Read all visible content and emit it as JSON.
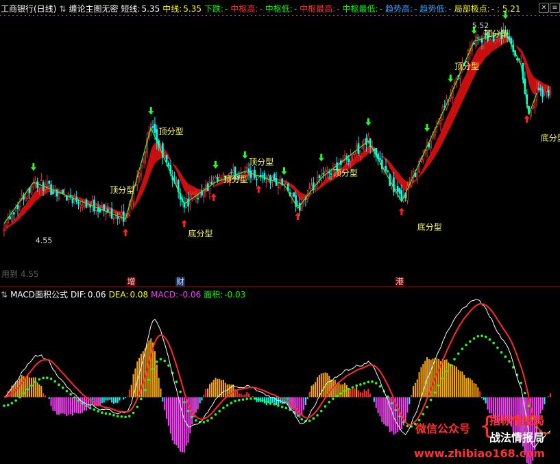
{
  "header": {
    "stock": "工商银行(日线)",
    "indicator": "缠论主图无密",
    "fields": [
      {
        "label": "短线:",
        "value": "5.35",
        "color": "#ffffff"
      },
      {
        "label": "中线:",
        "value": "5.35",
        "color": "#ffff00"
      },
      {
        "label": "下跌:",
        "value": "-",
        "color": "#00ff00"
      },
      {
        "label": "中枢高:",
        "value": "-",
        "color": "#ff3030"
      },
      {
        "label": "中枢低:",
        "value": "-",
        "color": "#00ff00"
      },
      {
        "label": "中枢最高:",
        "value": "-",
        "color": "#ff3030"
      },
      {
        "label": "中枢最低:",
        "value": "-",
        "color": "#00ff00"
      },
      {
        "label": "趋势高:",
        "value": "-",
        "color": "#40a0ff"
      },
      {
        "label": "趋势低:",
        "value": "-",
        "color": "#40a0ff"
      },
      {
        "label": "局部极点:",
        "value": "- : 5.21",
        "color": "#ffff00"
      }
    ]
  },
  "macd_header": {
    "title": "MACD面积公式",
    "fields": [
      {
        "label": "DIF:",
        "value": "0.06",
        "color": "#ffffff"
      },
      {
        "label": "DEA:",
        "value": "0.08",
        "color": "#ffff00"
      },
      {
        "label": "MACD:",
        "value": "-0.06",
        "color": "#ff40ff"
      },
      {
        "label": "面积:",
        "value": "-0.03",
        "color": "#00ff00"
      }
    ]
  },
  "icons": {
    "toggle": "swap-icon",
    "close": "close-icon",
    "menu": "menu-icon"
  },
  "colors": {
    "up": "#ff3030",
    "down": "#00ffff",
    "band": "#dd1111",
    "zigzag": "#33ff33",
    "text_yellow": "#ffff66",
    "buy": "#ff2020",
    "sell": "#22ff22",
    "separator": "#b00000"
  },
  "chart_data": [
    {
      "type": "candlestick",
      "ylim": [
        4.4,
        5.6
      ],
      "price_labels": [
        {
          "text": "5.52",
          "x_index": 239,
          "price": 5.54
        },
        {
          "text": "4.55",
          "x_index": 16,
          "price": 4.55
        }
      ],
      "top_pattern_label": "顶分型",
      "bottom_pattern_label": "底分型",
      "pattern_labels": [
        {
          "text": "顶分型",
          "x_index": 54,
          "price": 4.78
        },
        {
          "text": "顶分型",
          "x_index": 79,
          "price": 5.05
        },
        {
          "text": "顶分型",
          "x_index": 112,
          "price": 4.83
        },
        {
          "text": "顶分型",
          "x_index": 125,
          "price": 4.91
        },
        {
          "text": "顶分型",
          "x_index": 168,
          "price": 4.86
        },
        {
          "text": "顶分型",
          "x_index": 230,
          "price": 5.35
        },
        {
          "text": "顶分型",
          "x_index": 245,
          "price": 5.5
        },
        {
          "text": "底分型",
          "x_index": 94,
          "price": 4.58
        },
        {
          "text": "底分型",
          "x_index": 211,
          "price": 4.61
        },
        {
          "text": "底分型",
          "x_index": 274,
          "price": 5.02
        }
      ],
      "events": [
        {
          "text": "增",
          "x_index": 65,
          "color": "#ffcccc",
          "bg": "#880000"
        },
        {
          "text": "财",
          "x_index": 90,
          "color": "#cce0ff",
          "bg": "#224488"
        },
        {
          "text": "港",
          "x_index": 202,
          "color": "#ffcccc",
          "bg": "#880000"
        }
      ],
      "zigzag": [
        {
          "i": 0,
          "p": 4.64
        },
        {
          "i": 15,
          "p": 4.83
        },
        {
          "i": 62,
          "p": 4.66
        },
        {
          "i": 75,
          "p": 5.08
        },
        {
          "i": 92,
          "p": 4.73
        },
        {
          "i": 108,
          "p": 4.83
        },
        {
          "i": 123,
          "p": 4.88
        },
        {
          "i": 143,
          "p": 4.82
        },
        {
          "i": 150,
          "p": 4.71
        },
        {
          "i": 162,
          "p": 4.85
        },
        {
          "i": 186,
          "p": 5.02
        },
        {
          "i": 203,
          "p": 4.74
        },
        {
          "i": 228,
          "p": 5.23
        },
        {
          "i": 240,
          "p": 5.48
        },
        {
          "i": 256,
          "p": 5.52
        },
        {
          "i": 264,
          "p": 5.37
        },
        {
          "i": 268,
          "p": 5.14
        },
        {
          "i": 272,
          "p": 5.24
        }
      ],
      "buy_points": [
        {
          "i": 62
        },
        {
          "i": 92
        },
        {
          "i": 107
        },
        {
          "i": 130
        },
        {
          "i": 150
        },
        {
          "i": 203
        },
        {
          "i": 267
        }
      ],
      "sell_points": [
        {
          "i": 15
        },
        {
          "i": 75
        },
        {
          "i": 108
        },
        {
          "i": 123
        },
        {
          "i": 143
        },
        {
          "i": 162
        },
        {
          "i": 186
        },
        {
          "i": 216
        },
        {
          "i": 228
        },
        {
          "i": 240
        },
        {
          "i": 256
        }
      ]
    },
    {
      "type": "macd",
      "ylim": [
        -0.22,
        0.36
      ]
    }
  ],
  "watermark": {
    "brand": "微信公众号",
    "line1": "指标情报局",
    "line2": "战法情报局",
    "url": "www.zhibiao168.com",
    "faint": "用到 4.55"
  }
}
